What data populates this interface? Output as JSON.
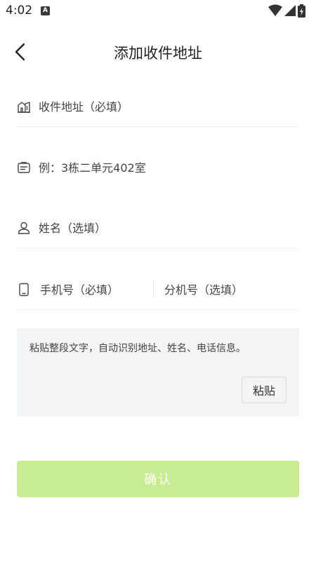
{
  "status_bar": {
    "time": "4:02",
    "notification_icon": "a-badge-icon",
    "icons": [
      "wifi-icon",
      "signal-icon",
      "battery-charging-icon"
    ]
  },
  "header": {
    "back_icon": "chevron-left-icon",
    "title": "添加收件地址"
  },
  "form": {
    "address": {
      "icon": "building-icon",
      "placeholder": "收件地址（必填）"
    },
    "detail": {
      "icon": "card-icon",
      "placeholder": "例：3栋二单元402室"
    },
    "name": {
      "icon": "person-icon",
      "placeholder": "姓名（选填）"
    },
    "phone": {
      "icon": "phone-icon",
      "placeholder": "手机号（必填）"
    },
    "extension": {
      "placeholder": "分机号（选填）"
    }
  },
  "paste_panel": {
    "placeholder": "粘贴整段文字，自动识别地址、姓名、电话信息。",
    "button_label": "粘贴"
  },
  "confirm_button": {
    "label": "确认",
    "color": "#c8ec92"
  }
}
